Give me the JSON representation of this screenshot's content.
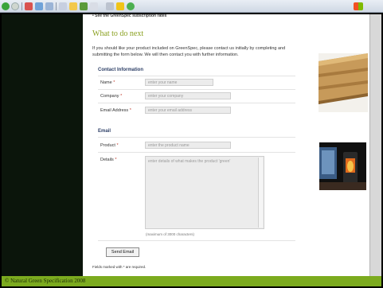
{
  "browser": {
    "toolbar_icons": [
      "back-icon",
      "forward-icon",
      "stop-icon",
      "refresh-icon",
      "home-icon",
      "search-icon",
      "favorites-icon",
      "history-icon",
      "mail-icon",
      "print-icon",
      "edit-icon",
      "messenger-icon"
    ]
  },
  "page": {
    "breadcrumb": "• See the GreenSpec subscription rates",
    "heading": "What to do next",
    "intro": "If you should like your product included on GreenSpec, please contact us initially by completing and submitting the form below. We will then contact you with further information."
  },
  "form": {
    "contact_section": "Contact Information",
    "name_label": "Name",
    "name_placeholder": "enter your name",
    "company_label": "Company",
    "company_placeholder": "enter your company",
    "email_label": "Email Address",
    "email_placeholder": "enter your email address",
    "email_section": "Email",
    "product_label": "Product",
    "product_placeholder": "enter the product name",
    "details_label": "Details",
    "details_placeholder": "enter details of what makes the product 'green'",
    "details_hint": "(maximum of 3000 characters)",
    "required_marker": "*",
    "send_button": "Send Email",
    "required_note": "Fields marked with * are required."
  },
  "footer": {
    "text": "© Natural Green Specification 2008"
  },
  "colors": {
    "accent_green": "#7cab1f",
    "heading_green": "#8aa020",
    "section_blue": "#2c3e66",
    "sidebar_dark": "#0b150b"
  }
}
